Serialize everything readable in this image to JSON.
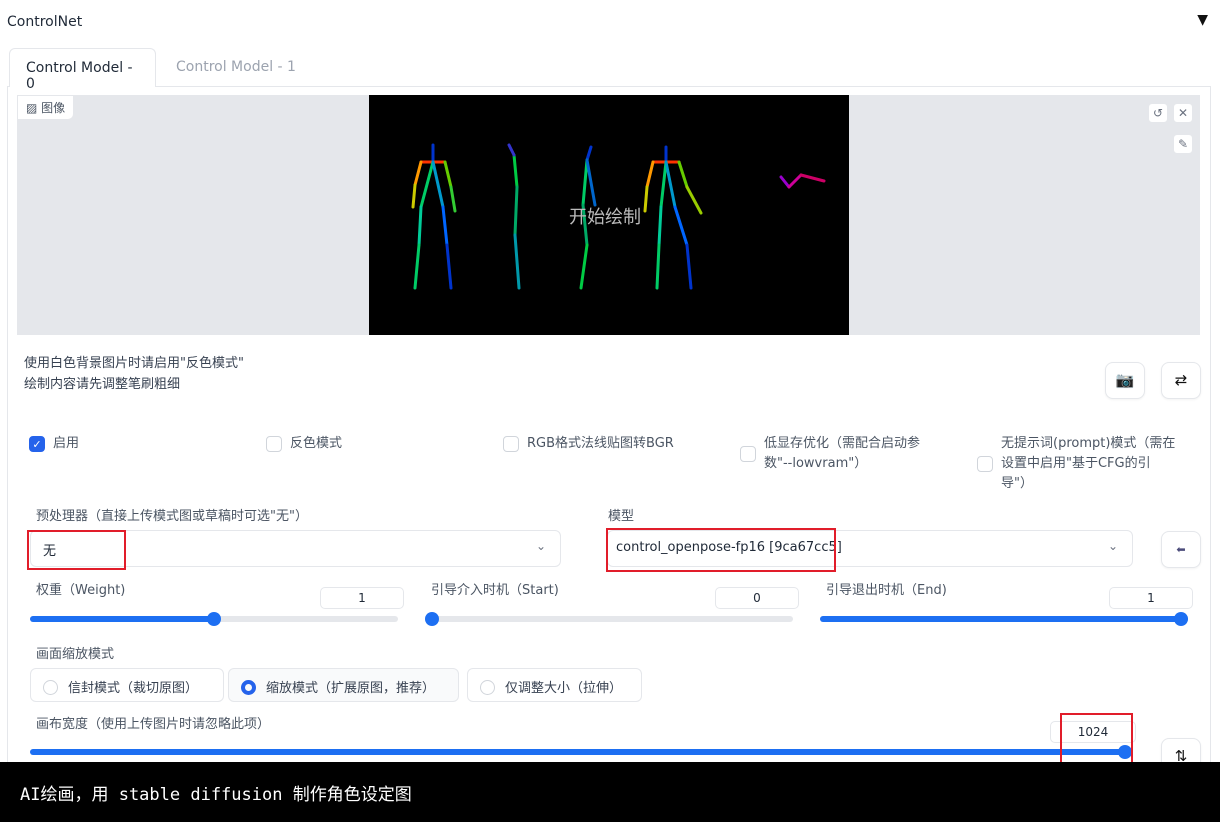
{
  "section": {
    "title": "ControlNet",
    "collapse_icon": "triangle-down-icon"
  },
  "tabs": [
    {
      "label": "Control Model - 0",
      "active": true
    },
    {
      "label": "Control Model - 1",
      "active": false
    }
  ],
  "image": {
    "label": "图像",
    "overlay_text": "开始绘制"
  },
  "hints": [
    "使用白色背景图片时请启用\"反色模式\"",
    "绘制内容请先调整笔刷粗细"
  ],
  "checkboxes": [
    {
      "label": "启用",
      "checked": true
    },
    {
      "label": "反色模式",
      "checked": false
    },
    {
      "label": "RGB格式法线贴图转BGR",
      "checked": false
    },
    {
      "label_lines": [
        "低显存优化（需配合启动参",
        "数\"--lowvram\"）"
      ],
      "checked": false
    },
    {
      "label_lines": [
        "无提示词(prompt)模式（需在",
        "设置中启用\"基于CFG的引",
        "导\"）"
      ],
      "checked": false
    }
  ],
  "preprocessor": {
    "label": "预处理器（直接上传模式图或草稿时可选\"无\"）",
    "value": "无"
  },
  "model": {
    "label": "模型",
    "value": "control_openpose-fp16 [9ca67cc5]"
  },
  "sliders": [
    {
      "label": "权重（Weight)",
      "value": "1",
      "fraction": 0.5
    },
    {
      "label": "引导介入时机（Start)",
      "value": "0",
      "fraction": 0
    },
    {
      "label": "引导退出时机（End)",
      "value": "1",
      "fraction": 1
    }
  ],
  "resize_mode": {
    "label": "画面缩放模式",
    "options": [
      "信封模式（裁切原图）",
      "缩放模式（扩展原图，推荐）",
      "仅调整大小（拉伸）"
    ],
    "selected": 1
  },
  "canvas_width": {
    "label": "画布宽度（使用上传图片时请忽略此项）",
    "value": "1024",
    "fraction": 1
  },
  "caption": "AI绘画，用 stable diffusion 制作角色设定图",
  "colors": {
    "accent": "#1d6ff2",
    "highlight_box": "#e11d2a"
  }
}
